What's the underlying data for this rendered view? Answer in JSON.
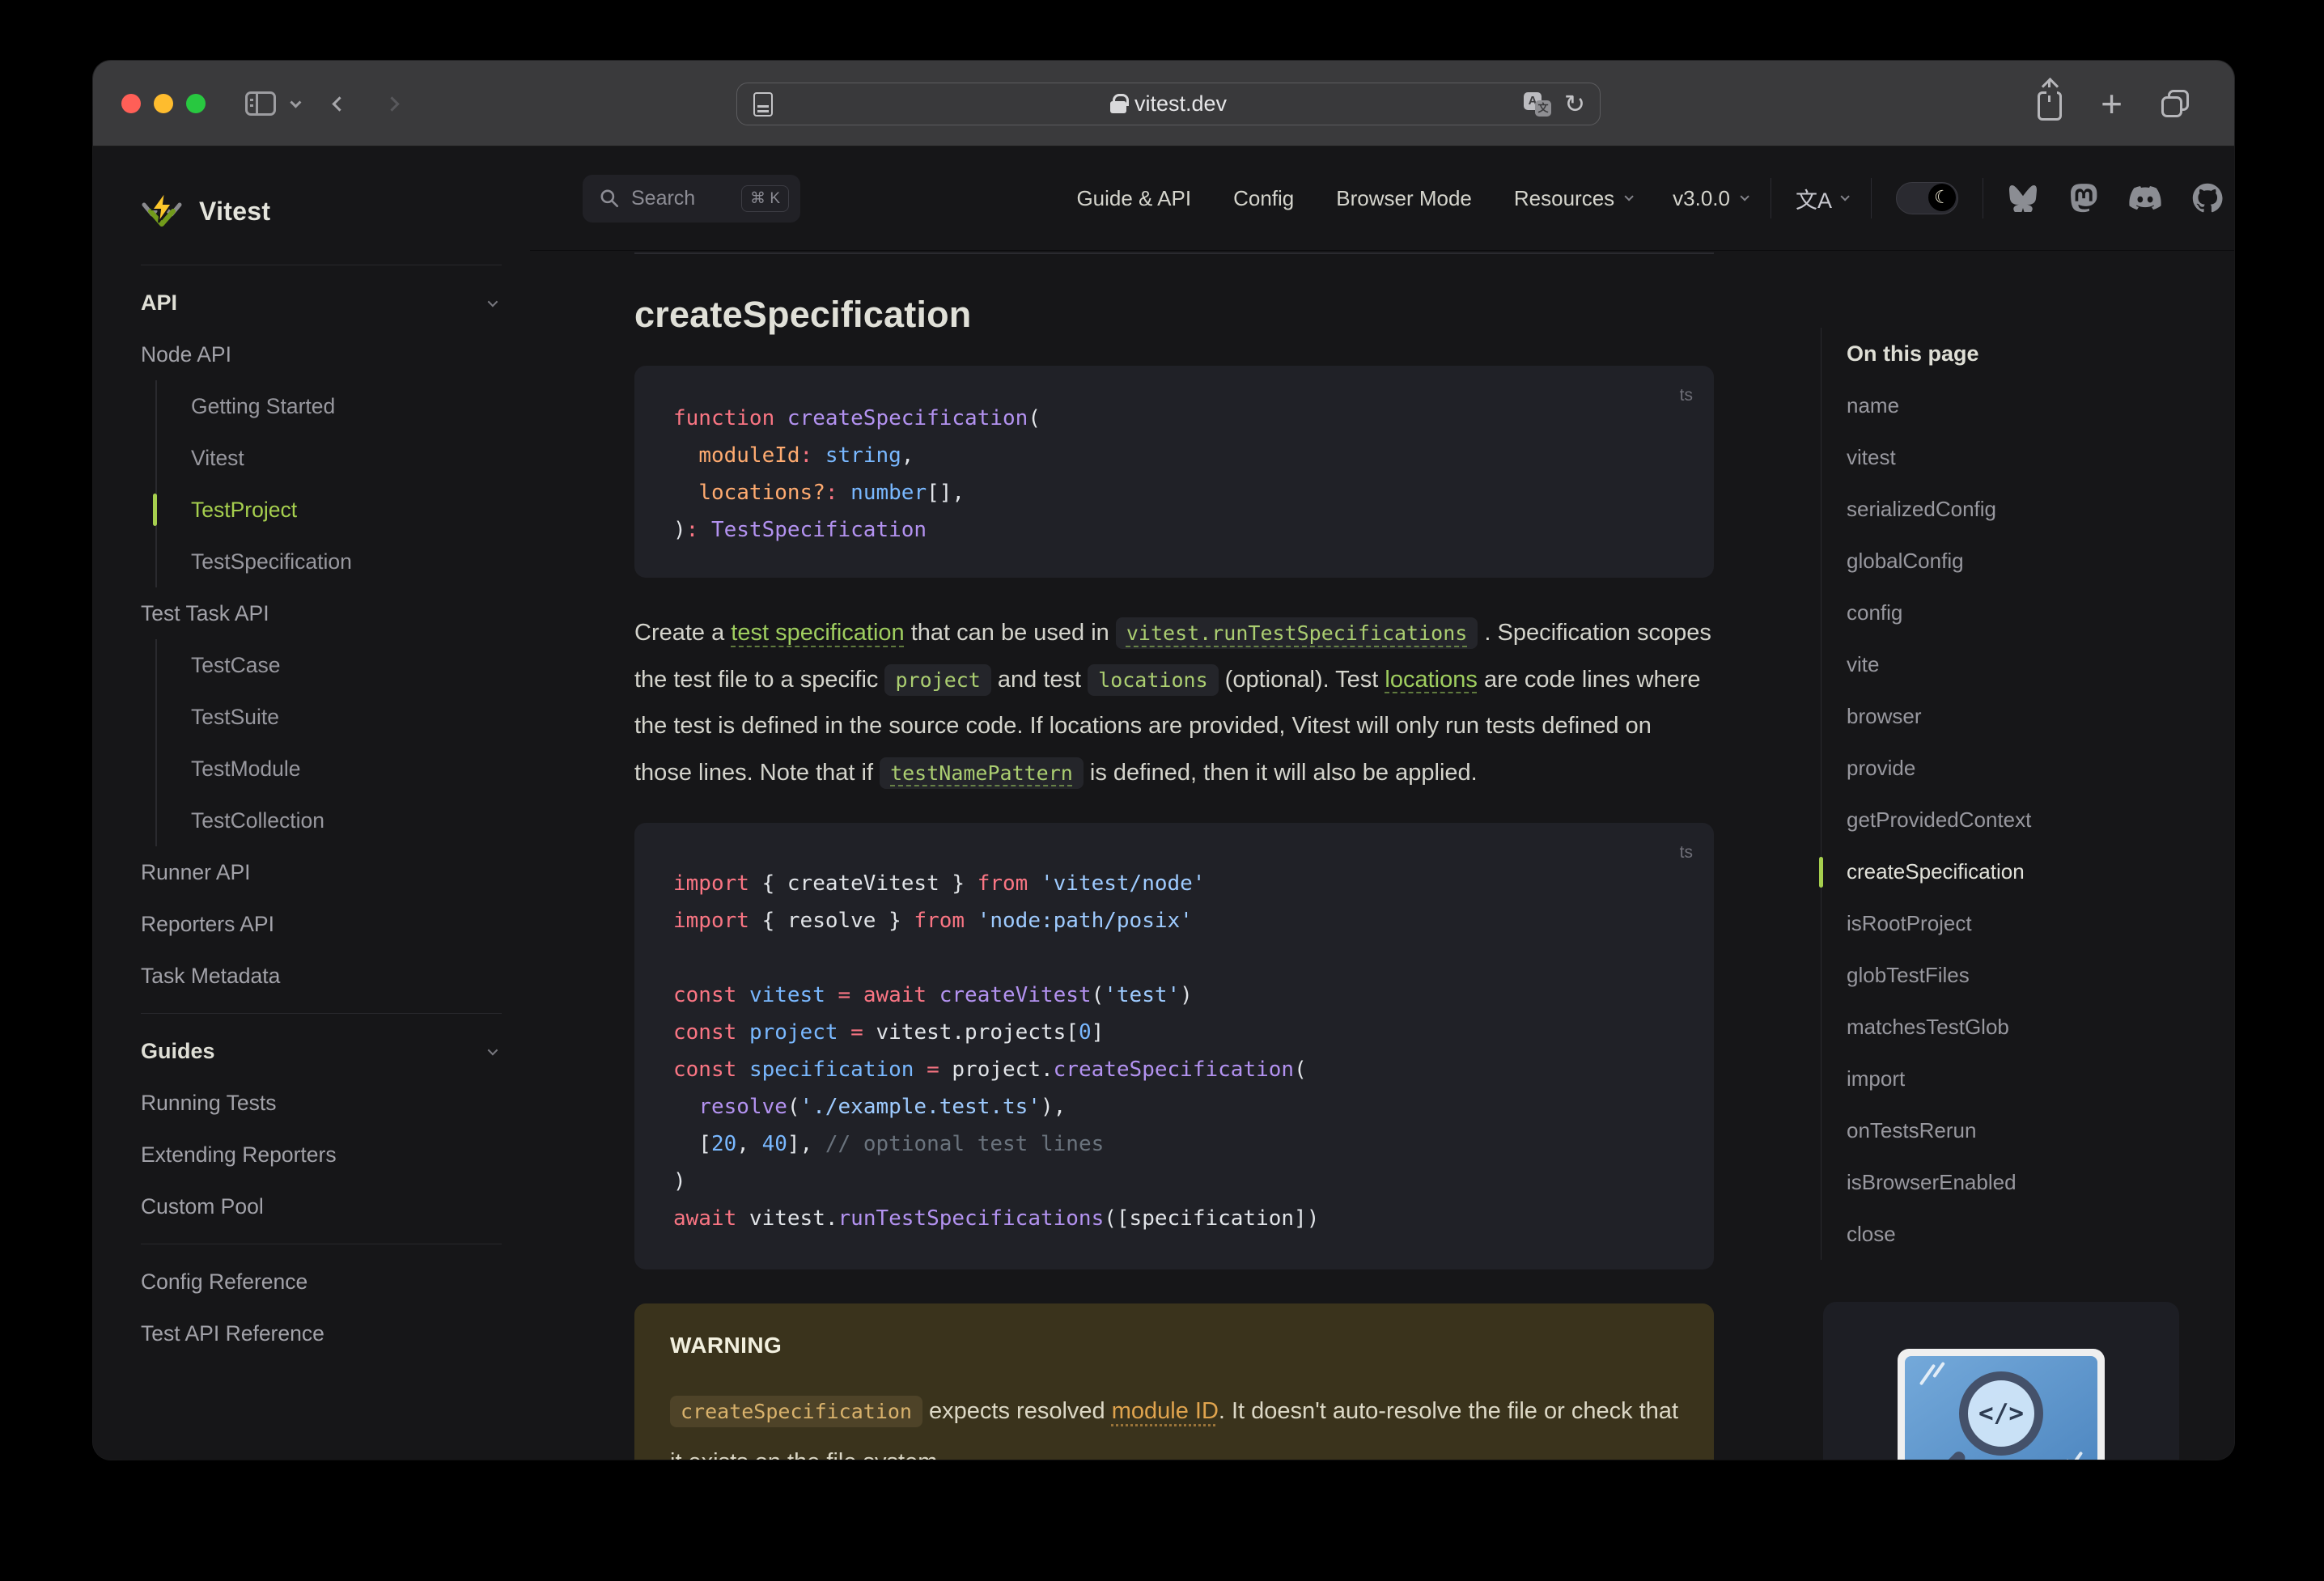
{
  "colors": {
    "brand_green": "#a6cf4e",
    "code_bg": "#202127",
    "warning_bg": "#3a331c",
    "syntax": {
      "keyword": "#f97583",
      "function": "#b392f0",
      "string": "#9ecbff",
      "constant": "#79b8ff",
      "parameter": "#ffab70",
      "plain": "#e1e4e8",
      "comment": "#6a737d"
    },
    "traffic_lights": [
      "#ff5f57",
      "#febc2e",
      "#28c840"
    ]
  },
  "chrome": {
    "url": "vitest.dev"
  },
  "navbar": {
    "search": {
      "label": "Search",
      "shortcut": "⌘ K"
    },
    "links": [
      {
        "label": "Guide & API",
        "chevron": false
      },
      {
        "label": "Config",
        "chevron": false
      },
      {
        "label": "Browser Mode",
        "chevron": false
      },
      {
        "label": "Resources",
        "chevron": true
      },
      {
        "label": "v3.0.0",
        "chevron": true
      }
    ],
    "language_glyph": "文A",
    "theme_moon": "☾"
  },
  "sidebar": {
    "logo_text": "Vitest",
    "entries": [
      {
        "type": "section",
        "label": "API"
      },
      {
        "type": "item",
        "label": "Node API"
      },
      {
        "type": "sub",
        "items": [
          {
            "label": "Getting Started",
            "active": false
          },
          {
            "label": "Vitest",
            "active": false
          },
          {
            "label": "TestProject",
            "active": true
          },
          {
            "label": "TestSpecification",
            "active": false
          }
        ]
      },
      {
        "type": "item",
        "label": "Test Task API"
      },
      {
        "type": "sub",
        "items": [
          {
            "label": "TestCase",
            "active": false
          },
          {
            "label": "TestSuite",
            "active": false
          },
          {
            "label": "TestModule",
            "active": false
          },
          {
            "label": "TestCollection",
            "active": false
          }
        ]
      },
      {
        "type": "item",
        "label": "Runner API"
      },
      {
        "type": "item",
        "label": "Reporters API"
      },
      {
        "type": "item",
        "label": "Task Metadata"
      },
      {
        "type": "divider"
      },
      {
        "type": "section",
        "label": "Guides"
      },
      {
        "type": "item",
        "label": "Running Tests"
      },
      {
        "type": "item",
        "label": "Extending Reporters"
      },
      {
        "type": "item",
        "label": "Custom Pool"
      },
      {
        "type": "divider"
      },
      {
        "type": "item",
        "label": "Config Reference"
      },
      {
        "type": "item",
        "label": "Test API Reference"
      }
    ]
  },
  "main": {
    "title": "createSpecification",
    "code_blocks": [
      {
        "lang": "ts",
        "lines": [
          [
            {
              "c": "k",
              "t": "function "
            },
            {
              "c": "f",
              "t": "createSpecification"
            },
            {
              "c": "p",
              "t": "("
            }
          ],
          [
            {
              "c": "p",
              "t": "  "
            },
            {
              "c": "o",
              "t": "moduleId"
            },
            {
              "c": "k",
              "t": ":"
            },
            {
              "c": "p",
              "t": " "
            },
            {
              "c": "v",
              "t": "string"
            },
            {
              "c": "p",
              "t": ","
            }
          ],
          [
            {
              "c": "p",
              "t": "  "
            },
            {
              "c": "o",
              "t": "locations?"
            },
            {
              "c": "k",
              "t": ":"
            },
            {
              "c": "p",
              "t": " "
            },
            {
              "c": "v",
              "t": "number"
            },
            {
              "c": "p",
              "t": "[],"
            }
          ],
          [
            {
              "c": "p",
              "t": ")"
            },
            {
              "c": "k",
              "t": ":"
            },
            {
              "c": "p",
              "t": " "
            },
            {
              "c": "f",
              "t": "TestSpecification"
            }
          ]
        ]
      },
      {
        "lang": "ts",
        "lines": [
          [
            {
              "c": "k",
              "t": "import"
            },
            {
              "c": "p",
              "t": " { createVitest } "
            },
            {
              "c": "k",
              "t": "from"
            },
            {
              "c": "p",
              "t": " "
            },
            {
              "c": "s",
              "t": "'vitest/node'"
            }
          ],
          [
            {
              "c": "k",
              "t": "import"
            },
            {
              "c": "p",
              "t": " { resolve } "
            },
            {
              "c": "k",
              "t": "from"
            },
            {
              "c": "p",
              "t": " "
            },
            {
              "c": "s",
              "t": "'node:path/posix'"
            }
          ],
          [],
          [
            {
              "c": "k",
              "t": "const"
            },
            {
              "c": "p",
              "t": " "
            },
            {
              "c": "v",
              "t": "vitest"
            },
            {
              "c": "p",
              "t": " "
            },
            {
              "c": "k",
              "t": "= await"
            },
            {
              "c": "p",
              "t": " "
            },
            {
              "c": "f",
              "t": "createVitest"
            },
            {
              "c": "p",
              "t": "("
            },
            {
              "c": "s",
              "t": "'test'"
            },
            {
              "c": "p",
              "t": ")"
            }
          ],
          [
            {
              "c": "k",
              "t": "const"
            },
            {
              "c": "p",
              "t": " "
            },
            {
              "c": "v",
              "t": "project"
            },
            {
              "c": "p",
              "t": " "
            },
            {
              "c": "k",
              "t": "="
            },
            {
              "c": "p",
              "t": " vitest.projects["
            },
            {
              "c": "v",
              "t": "0"
            },
            {
              "c": "p",
              "t": "]"
            }
          ],
          [
            {
              "c": "k",
              "t": "const"
            },
            {
              "c": "p",
              "t": " "
            },
            {
              "c": "v",
              "t": "specification"
            },
            {
              "c": "p",
              "t": " "
            },
            {
              "c": "k",
              "t": "="
            },
            {
              "c": "p",
              "t": " project."
            },
            {
              "c": "f",
              "t": "createSpecification"
            },
            {
              "c": "p",
              "t": "("
            }
          ],
          [
            {
              "c": "p",
              "t": "  "
            },
            {
              "c": "f",
              "t": "resolve"
            },
            {
              "c": "p",
              "t": "("
            },
            {
              "c": "s",
              "t": "'./example.test.ts'"
            },
            {
              "c": "p",
              "t": "),"
            }
          ],
          [
            {
              "c": "p",
              "t": "  ["
            },
            {
              "c": "v",
              "t": "20"
            },
            {
              "c": "p",
              "t": ", "
            },
            {
              "c": "v",
              "t": "40"
            },
            {
              "c": "p",
              "t": "], "
            },
            {
              "c": "c",
              "t": "// optional test lines"
            }
          ],
          [
            {
              "c": "p",
              "t": ")"
            }
          ],
          [
            {
              "c": "k",
              "t": "await"
            },
            {
              "c": "p",
              "t": " vitest."
            },
            {
              "c": "f",
              "t": "runTestSpecifications"
            },
            {
              "c": "p",
              "t": "([specification])"
            }
          ]
        ]
      }
    ],
    "paragraph": [
      {
        "k": "t",
        "t": "Create a "
      },
      {
        "k": "a",
        "t": "test specification"
      },
      {
        "k": "t",
        "t": " that can be used in "
      },
      {
        "k": "codea",
        "t": "vitest.runTestSpecifications"
      },
      {
        "k": "t",
        "t": " . Specification scopes the test file to a specific "
      },
      {
        "k": "code",
        "t": "project"
      },
      {
        "k": "t",
        "t": " and test "
      },
      {
        "k": "code",
        "t": "locations"
      },
      {
        "k": "t",
        "t": " (optional). Test "
      },
      {
        "k": "a",
        "t": "locations"
      },
      {
        "k": "t",
        "t": " are code lines where the test is defined in the source code. If locations are provided, Vitest will only run tests defined on those lines. Note that if "
      },
      {
        "k": "codea",
        "t": "testNamePattern"
      },
      {
        "k": "t",
        "t": " is defined, then it will also be applied."
      }
    ],
    "warning": {
      "title": "WARNING",
      "body": [
        {
          "k": "wcode",
          "t": "createSpecification"
        },
        {
          "k": "t",
          "t": " expects resolved "
        },
        {
          "k": "wa",
          "t": "module ID"
        },
        {
          "k": "t",
          "t": ". It doesn't auto-resolve the file or check that it exists on the file system."
        }
      ]
    }
  },
  "toc": {
    "title": "On this page",
    "items": [
      {
        "label": "name",
        "active": false
      },
      {
        "label": "vitest",
        "active": false
      },
      {
        "label": "serializedConfig",
        "active": false
      },
      {
        "label": "globalConfig",
        "active": false
      },
      {
        "label": "config",
        "active": false
      },
      {
        "label": "vite",
        "active": false
      },
      {
        "label": "browser",
        "active": false
      },
      {
        "label": "provide",
        "active": false
      },
      {
        "label": "getProvidedContext",
        "active": false
      },
      {
        "label": "createSpecification",
        "active": true
      },
      {
        "label": "isRootProject",
        "active": false
      },
      {
        "label": "globTestFiles",
        "active": false
      },
      {
        "label": "matchesTestGlob",
        "active": false
      },
      {
        "label": "import",
        "active": false
      },
      {
        "label": "onTestsRerun",
        "active": false
      },
      {
        "label": "isBrowserEnabled",
        "active": false
      },
      {
        "label": "close",
        "active": false
      }
    ]
  },
  "ad": {
    "image_alt": "code-search-monitor-illustration",
    "glyph": "</>"
  }
}
